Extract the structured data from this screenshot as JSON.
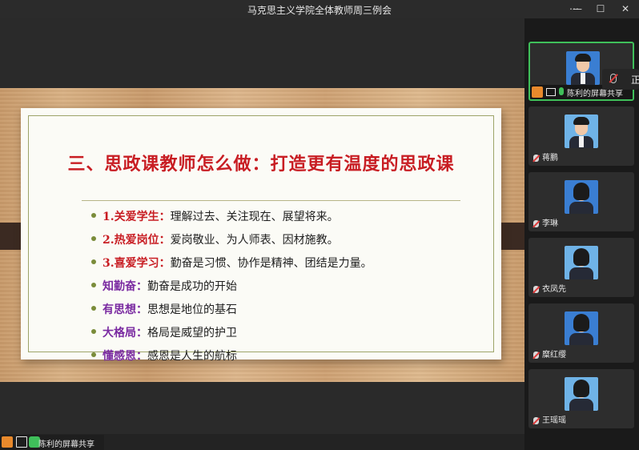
{
  "window": {
    "title": "马克思主义学院全体教师周三例会",
    "icons": [
      "pin-icon",
      "minimize-icon",
      "maximize-icon",
      "close-icon"
    ]
  },
  "slide": {
    "title": "三、思政课教师怎么做：打造更有温度的思政课",
    "bullets": [
      {
        "keyword": "1.关爱学生：",
        "text": "理解过去、关注现在、展望将来。",
        "color": "red"
      },
      {
        "keyword": "2.热爱岗位：",
        "text": "爱岗敬业、为人师表、因材施教。",
        "color": "red"
      },
      {
        "keyword": "3.喜爱学习：",
        "text": "勤奋是习惯、协作是精神、团结是力量。",
        "color": "red"
      },
      {
        "keyword": "知勤奋：",
        "text": "勤奋是成功的开始",
        "color": "purple"
      },
      {
        "keyword": "有思想：",
        "text": "思想是地位的基石",
        "color": "purple"
      },
      {
        "keyword": "大格局：",
        "text": "格局是威望的护卫",
        "color": "purple"
      },
      {
        "keyword": "懂感恩：",
        "text": "感恩是人生的航标",
        "color": "purple"
      }
    ],
    "colors": {
      "title": "#c81d23",
      "keyword_red": "#c81d23",
      "keyword_purple": "#7a2aa1"
    }
  },
  "share": {
    "label": "陈利的屏幕共享"
  },
  "participants": [
    {
      "name": "陈利的屏幕共享",
      "active": true
    },
    {
      "name": "蒋鹏"
    },
    {
      "name": "李琳"
    },
    {
      "name": "衣凤先"
    },
    {
      "name": "糜红缨"
    },
    {
      "name": "王瑶瑶"
    }
  ],
  "popover": {
    "text": "正"
  }
}
